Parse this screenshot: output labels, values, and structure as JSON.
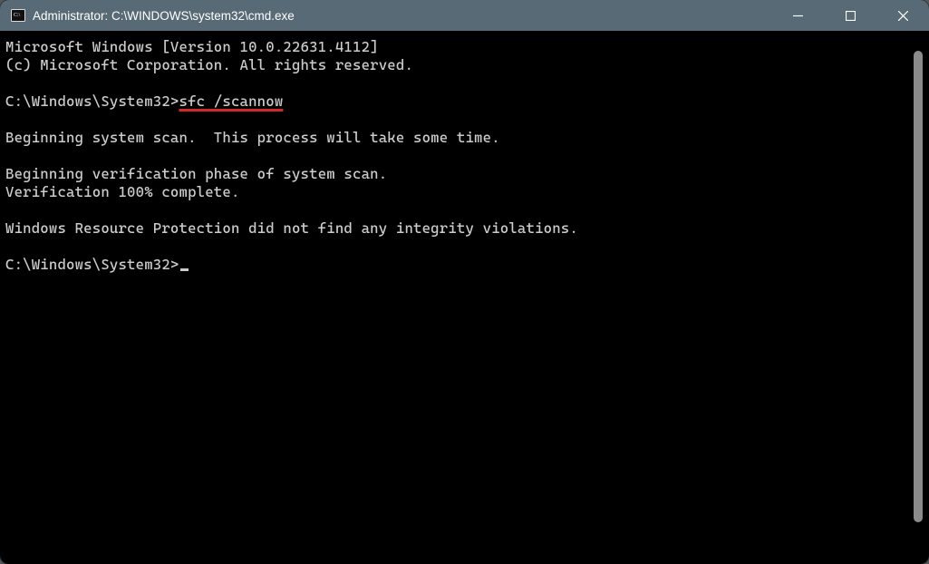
{
  "window": {
    "title": "Administrator: C:\\WINDOWS\\system32\\cmd.exe"
  },
  "terminal": {
    "line1": "Microsoft Windows [Version 10.0.22631.4112]",
    "line2": "(c) Microsoft Corporation. All rights reserved.",
    "prompt1_path": "C:\\Windows\\System32>",
    "prompt1_cmd": "sfc /scannow",
    "line_blank": "",
    "line4": "Beginning system scan.  This process will take some time.",
    "line6": "Beginning verification phase of system scan.",
    "line7": "Verification 100% complete.",
    "line9": "Windows Resource Protection did not find any integrity violations.",
    "prompt2_path": "C:\\Windows\\System32>"
  }
}
